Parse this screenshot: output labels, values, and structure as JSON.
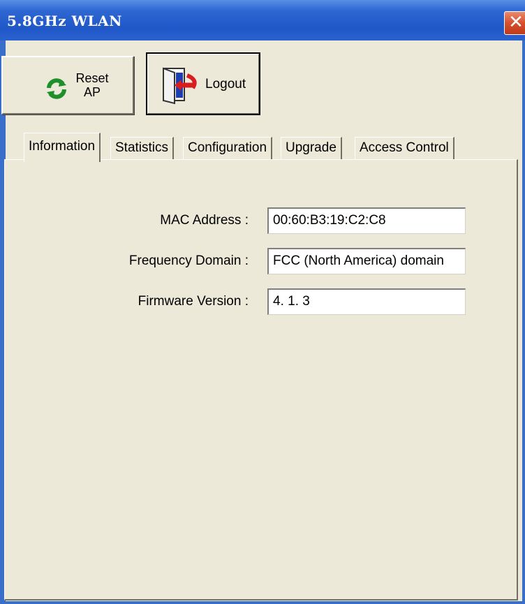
{
  "window": {
    "title": "5.8GHz WLAN",
    "close_glyph": "✕"
  },
  "toolbar": {
    "reset_label_line1": "Reset",
    "reset_label_line2": "AP",
    "reset_icon": "refresh-icon",
    "logout_label": "Logout",
    "logout_icon": "door-exit-icon"
  },
  "tabs": [
    {
      "label": "Information",
      "active": true
    },
    {
      "label": "Statistics",
      "active": false
    },
    {
      "label": "Configuration",
      "active": false
    },
    {
      "label": "Upgrade",
      "active": false
    },
    {
      "label": "Access Control",
      "active": false
    }
  ],
  "information": {
    "mac_label": "MAC Address :",
    "mac_value": "00:60:B3:19:C2:C8",
    "freq_label": "Frequency Domain :",
    "freq_value": "FCC (North America) domain",
    "fw_label": "Firmware Version :",
    "fw_value": "4. 1. 3"
  },
  "colors": {
    "titlebar": "#2f68d2",
    "window_bg": "#ece9d8",
    "close_button": "#d6512d"
  }
}
